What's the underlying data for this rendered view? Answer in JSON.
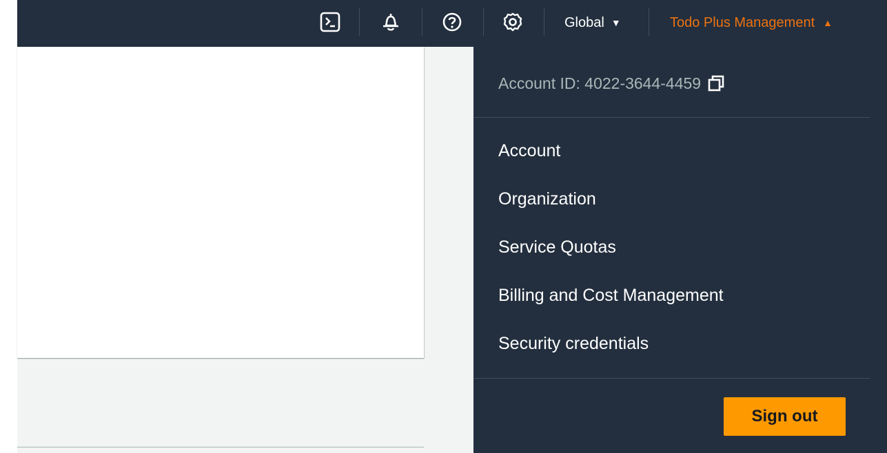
{
  "topbar": {
    "icons": [
      {
        "name": "cloudshell-icon"
      },
      {
        "name": "notifications-bell-icon"
      },
      {
        "name": "help-icon"
      },
      {
        "name": "settings-gear-icon"
      }
    ],
    "region_label": "Global",
    "region_caret": "▼",
    "account_menu_label": "Todo Plus Management",
    "account_menu_caret": "▲"
  },
  "dropdown": {
    "account_id": "Account ID: 4022-3644-4459",
    "items": [
      {
        "label": "Account"
      },
      {
        "label": "Organization"
      },
      {
        "label": "Service Quotas"
      },
      {
        "label": "Billing and Cost Management"
      },
      {
        "label": "Security credentials"
      }
    ],
    "sign_out_label": "Sign out"
  },
  "colors": {
    "nav_bg": "#232f3e",
    "accent_orange": "#ec7211",
    "button_orange": "#ff9900",
    "muted_text": "#aab7b8",
    "page_bg": "#f2f3f3"
  }
}
